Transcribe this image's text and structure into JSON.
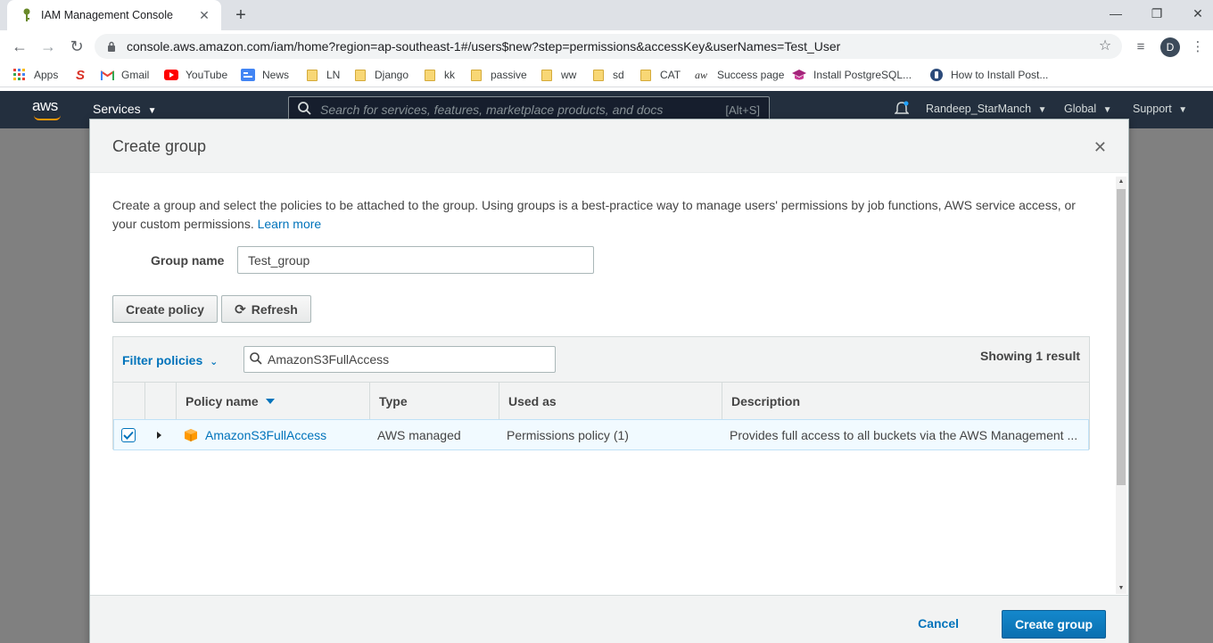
{
  "browser": {
    "tab_title": "IAM Management Console",
    "url": "console.aws.amazon.com/iam/home?region=ap-southeast-1#/users$new?step=permissions&accessKey&userNames=Test_User",
    "profile_initial": "D",
    "bookmarks": [
      {
        "label": "Apps",
        "icon": "apps-grid-icon"
      },
      {
        "label": "",
        "icon": "s-logo-icon"
      },
      {
        "label": "Gmail",
        "icon": "gmail-icon"
      },
      {
        "label": "YouTube",
        "icon": "youtube-icon"
      },
      {
        "label": "News",
        "icon": "google-news-icon"
      },
      {
        "label": "LN",
        "icon": "folder-icon"
      },
      {
        "label": "Django",
        "icon": "folder-icon"
      },
      {
        "label": "kk",
        "icon": "folder-icon"
      },
      {
        "label": "passive",
        "icon": "folder-icon"
      },
      {
        "label": "ww",
        "icon": "folder-icon"
      },
      {
        "label": "sd",
        "icon": "folder-icon"
      },
      {
        "label": "CAT",
        "icon": "folder-icon"
      },
      {
        "label": "Success page",
        "icon": "aw-icon"
      },
      {
        "label": "Install PostgreSQL...",
        "icon": "graduation-cap-icon"
      },
      {
        "label": "How to Install Post...",
        "icon": "shield-icon"
      }
    ]
  },
  "aws_nav": {
    "logo": "aws",
    "services_label": "Services",
    "search_placeholder": "Search for services, features, marketplace products, and docs",
    "search_shortcut": "[Alt+S]",
    "account": "Randeep_StarManch",
    "region": "Global",
    "support": "Support"
  },
  "modal": {
    "title": "Create group",
    "intro_text": "Create a group and select the policies to be attached to the group. Using groups is a best-practice way to manage users' permissions by job functions, AWS service access, or your custom permissions.",
    "learn_more": "Learn more",
    "group_name_label": "Group name",
    "group_name_value": "Test_group",
    "create_policy_label": "Create policy",
    "refresh_label": "Refresh",
    "filter_label": "Filter policies",
    "search_value": "AmazonS3FullAccess",
    "showing_text": "Showing 1 result",
    "columns": [
      "Policy name",
      "Type",
      "Used as",
      "Description"
    ],
    "rows": [
      {
        "checked": true,
        "policy_name": "AmazonS3FullAccess",
        "type": "AWS managed",
        "used_as": "Permissions policy (1)",
        "description": "Provides full access to all buckets via the AWS Management ..."
      }
    ],
    "cancel_label": "Cancel",
    "submit_label": "Create group"
  },
  "colors": {
    "link": "#0073bb",
    "aws_nav_bg": "#232f3e",
    "primary_button": "#0a6fb0",
    "aws_orange": "#ff9900"
  }
}
